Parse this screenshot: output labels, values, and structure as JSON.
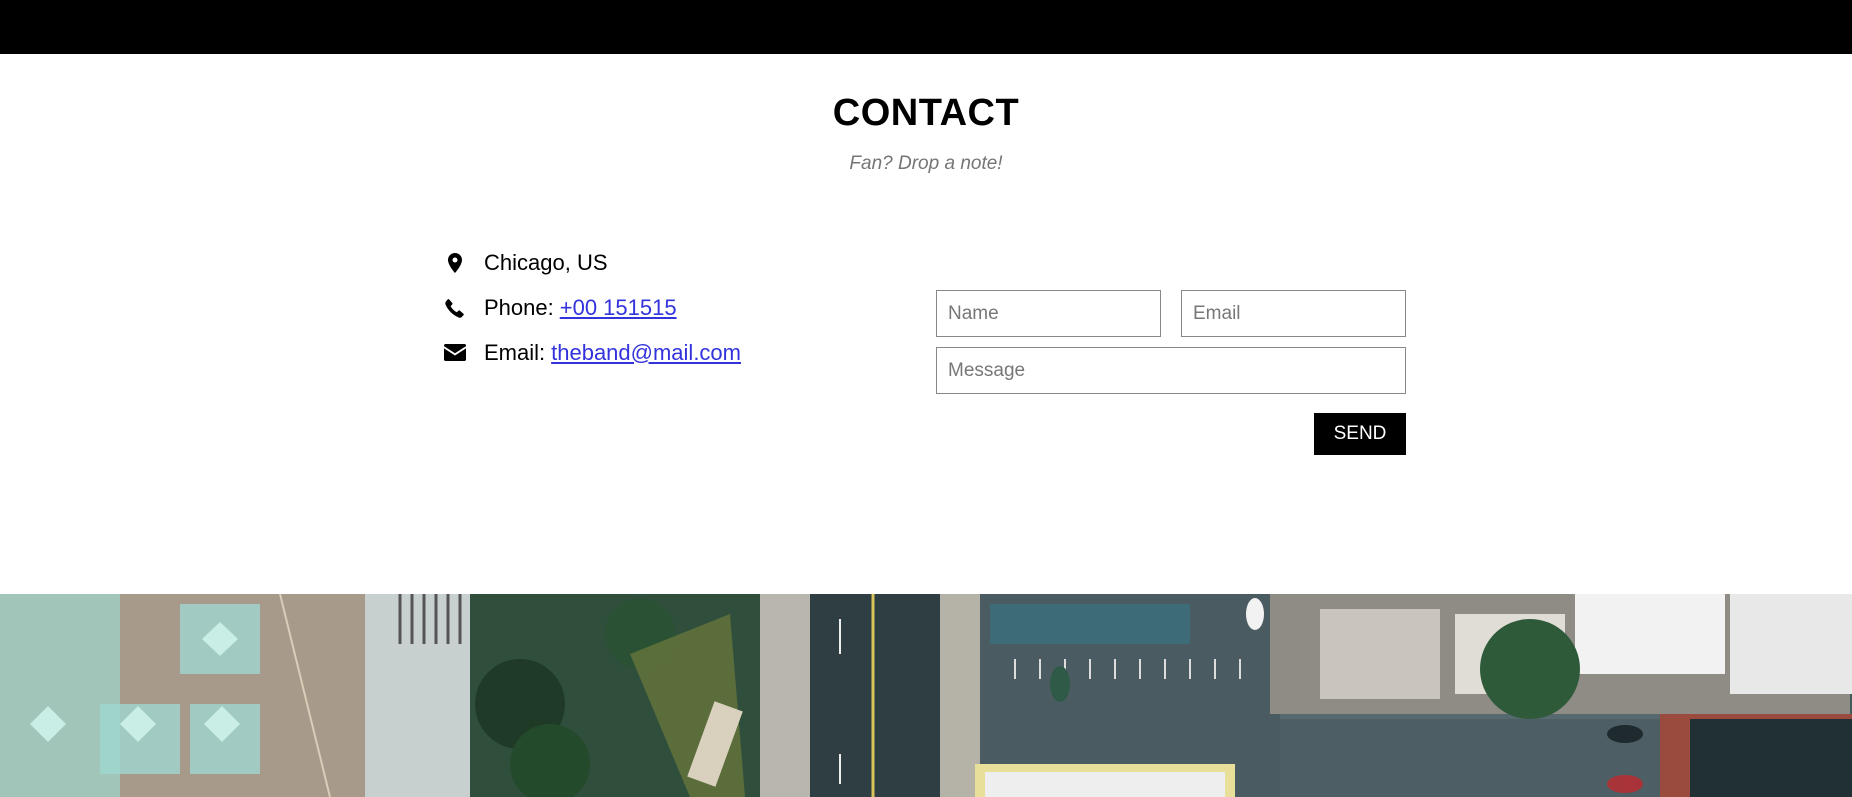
{
  "contact": {
    "title": "CONTACT",
    "subtitle": "Fan? Drop a note!",
    "info": {
      "location": "Chicago, US",
      "phone_label": "Phone:",
      "phone_value": "+00 151515",
      "email_label": "Email:",
      "email_value": "theband@mail.com"
    },
    "form": {
      "name_placeholder": "Name",
      "email_placeholder": "Email",
      "message_placeholder": "Message",
      "send_label": "SEND"
    }
  },
  "icons": {
    "location": "map-marker-icon",
    "phone": "phone-icon",
    "email": "envelope-icon"
  },
  "colors": {
    "topbar": "#000000",
    "link": "#3333dd",
    "button": "#000000"
  }
}
